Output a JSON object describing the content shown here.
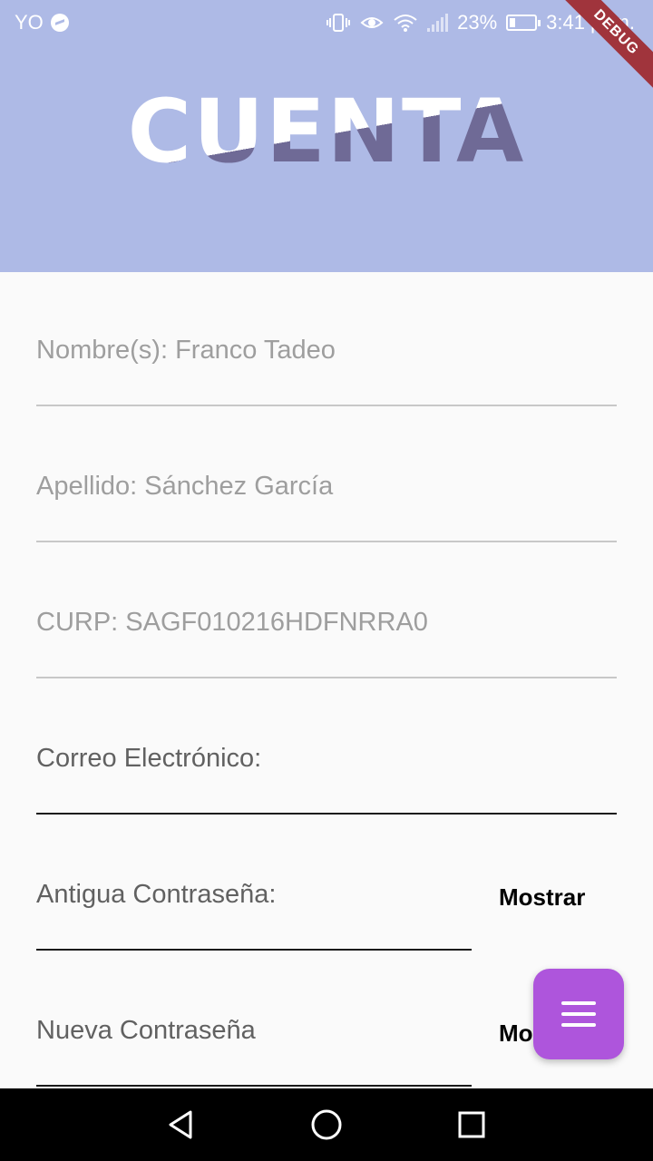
{
  "status_bar": {
    "carrier": "YO",
    "battery": "23%",
    "time": "3:41 p. m."
  },
  "header": {
    "title": "CUENTA",
    "debug_banner": "DEBUG"
  },
  "form": {
    "nombre": "Nombre(s): Franco Tadeo",
    "apellido": "Apellido: Sánchez García",
    "curp": "CURP: SAGF010216HDFNRRA0",
    "correo": "Correo Electrónico:",
    "antigua": "Antigua Contraseña:",
    "antigua_show": "Mostrar",
    "nueva": "Nueva Contraseña",
    "nueva_show": "Mostrar"
  },
  "fab": {
    "icon": "menu-icon"
  },
  "nav": {
    "back_icon": "back-icon",
    "home_icon": "home-icon",
    "recents_icon": "recents-icon"
  },
  "colors": {
    "header_bg": "#aebae6",
    "title_shadow": "#6f6a96",
    "fab": "#ae55dc",
    "debug": "#a0343c"
  }
}
